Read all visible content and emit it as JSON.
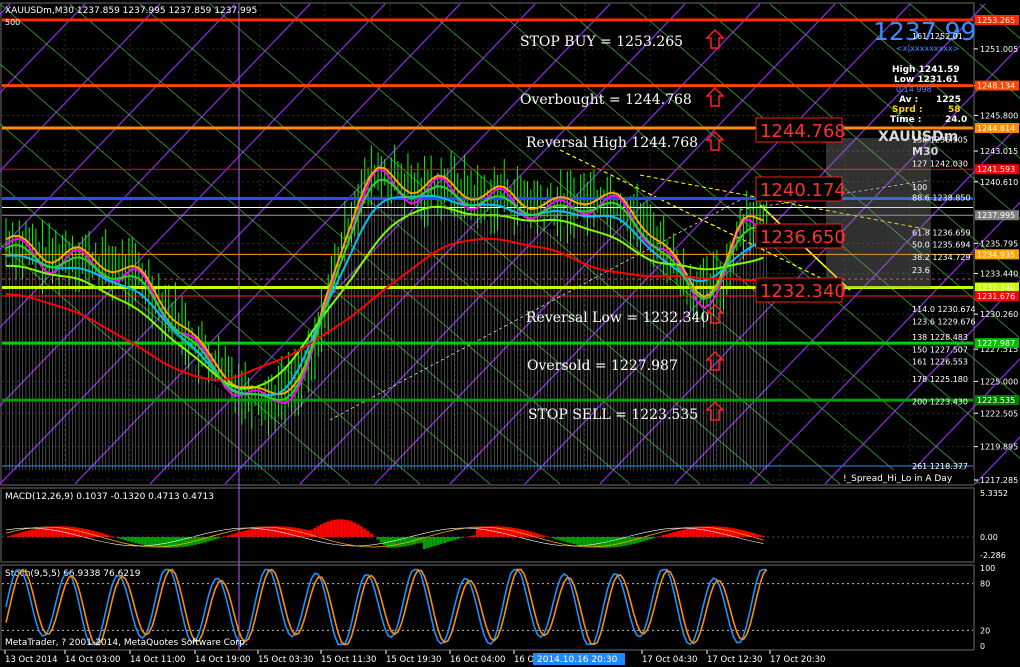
{
  "chart": {
    "symbol_line": "XAUUSDm,M30 1237.859 1237.995 1237.859 1237.995",
    "corner_value": "500",
    "price_big": "1237.99",
    "price_sub": "<x|xxxxxxxxx>",
    "watermark_symbol": "XAUUSDm",
    "watermark_tf": "M30",
    "copyright": "MetaTrader, ? 2001-2014, MetaQuotes Software Corp.",
    "indicator_label": "!_Spread_Hi_Lo in A Day"
  },
  "colors": {
    "background": "#000000",
    "grid": "#3a3a3a",
    "bull_candle": "#00ff00",
    "red_level": "#ff2a00",
    "orange_level": "#ff8c00",
    "yellow_level": "#c8ff00",
    "green_level": "#00c000",
    "price_blue": "#3b8bff",
    "macd_red": "#ff0000",
    "macd_green": "#00a000",
    "stoch_blue": "#1e90ff",
    "stoch_orange": "#ff8c00"
  },
  "info_panel": {
    "high": "High 1241.59",
    "low": "Low 1231.61",
    "small": "0.14    998",
    "av_label": "Av :",
    "av_value": "1225",
    "sprd_label": "Sprd :",
    "sprd_value": "58",
    "time_label": "Time :",
    "time_value": "24.0"
  },
  "levels_text": [
    {
      "label": "STOP BUY  =  1253.265"
    },
    {
      "label": "Overbought  =  1244.768"
    },
    {
      "label": "Reversal High 1244.768"
    },
    {
      "label": "Reversal Low = 1232.340"
    },
    {
      "label": "Oversold  =  1227.987"
    },
    {
      "label": "STOP SELL  =  1223.535"
    }
  ],
  "big_labels": [
    "1244.768",
    "1240.174",
    "1236.650",
    "1232.340"
  ],
  "fib_labels": [
    {
      "label": "161  1252.01",
      "price": 1252.01
    },
    {
      "label": "138  1236.905",
      "price": 1243.9
    },
    {
      "label": "127  1242.030",
      "price": 1242.03
    },
    {
      "label": "100",
      "price": 1240.2
    },
    {
      "label": "88.6  1238.850",
      "price": 1239.4
    },
    {
      "label": "61.8  1236.659",
      "price": 1236.66
    },
    {
      "label": "50.0  1235.694",
      "price": 1235.69
    },
    {
      "label": "38.2  1234.729",
      "price": 1234.73
    },
    {
      "label": "23.6",
      "price": 1233.7
    },
    {
      "label": "114.0  1230.674",
      "price": 1230.67
    },
    {
      "label": "123.6  1229.676",
      "price": 1229.68
    },
    {
      "label": "138  1228.483",
      "price": 1228.48
    },
    {
      "label": "150  1227.507",
      "price": 1227.51
    },
    {
      "label": "161  1226.553",
      "price": 1226.55
    },
    {
      "label": "178  1225.180",
      "price": 1225.18
    },
    {
      "label": "200  1223.430",
      "price": 1223.43
    },
    {
      "label": "261  1218.377",
      "price": 1218.38
    }
  ],
  "right_tags": [
    {
      "label": "1253.265",
      "price": 1253.265,
      "color": "#ff2a00"
    },
    {
      "label": "1248.134",
      "price": 1248.134,
      "color": "#ff4500"
    },
    {
      "label": "1244.814",
      "price": 1244.814,
      "color": "#ff8c00"
    },
    {
      "label": "1241.593",
      "price": 1241.593,
      "color": "#ff0000"
    },
    {
      "label": "1237.995",
      "price": 1237.995,
      "color": "#808080"
    },
    {
      "label": "1234.935",
      "price": 1234.935,
      "color": "#ffa500"
    },
    {
      "label": "1232.340",
      "price": 1232.34,
      "color": "#c8ff00"
    },
    {
      "label": "1231.676",
      "price": 1231.676,
      "color": "#ff0000"
    },
    {
      "label": "1227.987",
      "price": 1227.987,
      "color": "#00c000"
    },
    {
      "label": "1223.535",
      "price": 1223.535,
      "color": "#008000"
    }
  ],
  "price_axis": [
    "1251.005",
    "1248.130",
    "1245.800",
    "1243.015",
    "1240.610",
    "1235.795",
    "1233.440",
    "1230.260",
    "1227.515",
    "1225.000",
    "1222.505",
    "1219.895",
    "1217.285"
  ],
  "price_axis_values": [
    1251.005,
    1248.13,
    1245.8,
    1243.015,
    1240.61,
    1235.795,
    1233.44,
    1230.26,
    1227.515,
    1225.0,
    1222.505,
    1219.895,
    1217.285
  ],
  "macd": {
    "label": "MACD(12,26,9) 0.1037 -0.1320 0.4713 0.4713",
    "axis": [
      "5.3352",
      "0.00",
      "-2.286"
    ],
    "axis_values": [
      5.3352,
      0.0,
      -2.286
    ]
  },
  "stoch": {
    "label": "Stoch(9,5,5) 66.9338 76.6219",
    "axis": [
      "100",
      "80",
      "20",
      "0"
    ],
    "axis_values": [
      100,
      80,
      20,
      0
    ]
  },
  "time_axis": [
    "13 Oct 2014",
    "14 Oct 03:00",
    "14 Oct 11:00",
    "14 Oct 19:00",
    "15 Oct 03:30",
    "15 Oct 11:30",
    "15 Oct 19:30",
    "16 Oct 04:00",
    "16 Oct 12:00",
    "17 Oct 04:30",
    "17 Oct 12:30",
    "17 Oct 20:30"
  ],
  "crosshair_time": "2014.10.16 20:30",
  "chart_data": {
    "type": "line",
    "title": "XAUUSDm,M30",
    "series": [
      {
        "name": "XAUUSDm M30 close",
        "values": [
          1236.0,
          1235.3,
          1234.5,
          1235.0,
          1234.2,
          1233.9,
          1233.4,
          1231.5,
          1229.6,
          1227.1,
          1225.8,
          1224.2,
          1223.4,
          1224.6,
          1226.2,
          1232.8,
          1238.6,
          1241.2,
          1240.7,
          1239.7,
          1240.5,
          1239.9,
          1239.1,
          1239.7,
          1238.9,
          1238.4,
          1238.9,
          1239.4,
          1239.1,
          1237.8,
          1236.2,
          1233.4,
          1231.6,
          1233.0,
          1237.8,
          1237.99
        ]
      }
    ],
    "ylim": [
      1217.285,
      1253.265
    ]
  }
}
